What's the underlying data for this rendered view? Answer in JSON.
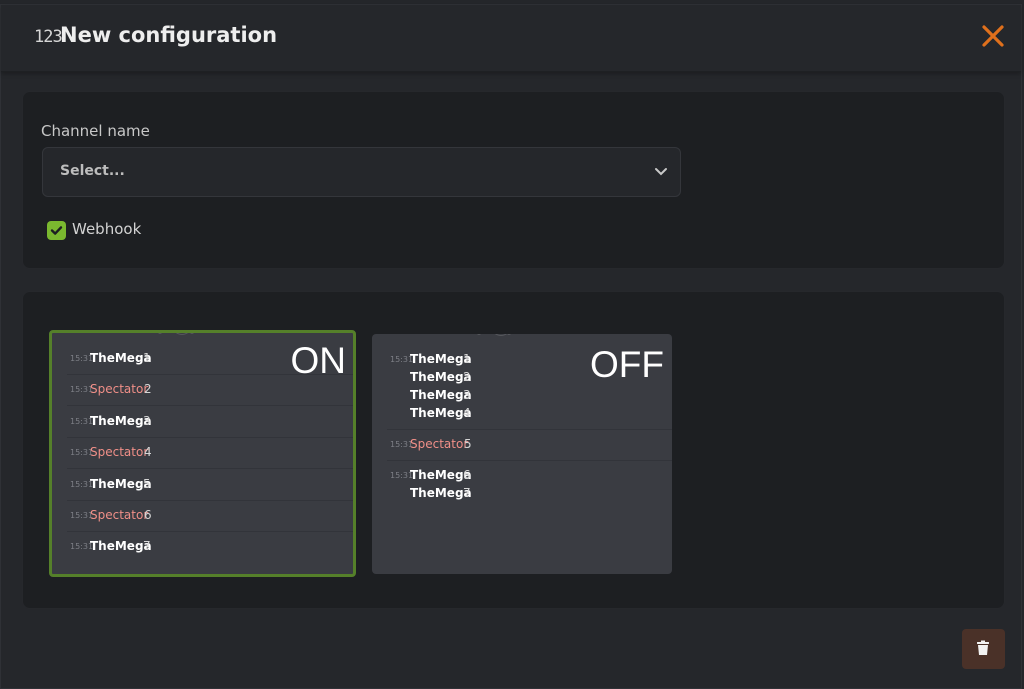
{
  "header": {
    "icon": "numbers-icon",
    "icon_text": "123",
    "title": "New configuration"
  },
  "form": {
    "channel_label": "Channel name",
    "channel_select_value": "Select...",
    "webhook_label": "Webhook",
    "webhook_checked": true
  },
  "preview_on": {
    "title": "ON",
    "messages": [
      {
        "time": "15:31",
        "user": "TheMega",
        "num": "1",
        "spectator": false
      },
      {
        "time": "15:31",
        "user": "Spectator",
        "num": "2",
        "spectator": true
      },
      {
        "time": "15:31",
        "user": "TheMega",
        "num": "3",
        "spectator": false
      },
      {
        "time": "15:31",
        "user": "Spectator",
        "num": "4",
        "spectator": true
      },
      {
        "time": "15:31",
        "user": "TheMega",
        "num": "5",
        "spectator": false
      },
      {
        "time": "15:31",
        "user": "Spectator",
        "num": "6",
        "spectator": true
      },
      {
        "time": "15:31",
        "user": "TheMega",
        "num": "7",
        "spectator": false
      }
    ]
  },
  "preview_off": {
    "title": "OFF",
    "groups": [
      {
        "time": "15:31",
        "user": "TheMega",
        "lines": [
          "1",
          "2",
          "3",
          "4"
        ],
        "spectator": false
      },
      {
        "time": "15:31",
        "user": "Spectator",
        "lines": [
          "5"
        ],
        "spectator": true
      },
      {
        "time": "15:31",
        "user": "TheMega",
        "lines": [
          "6",
          "7"
        ],
        "spectator": false
      }
    ]
  },
  "colors": {
    "accent_close": "#e0701c",
    "checkbox": "#7ab82f",
    "on_border": "#55802a",
    "spectator": "#f08f88",
    "delete_bg": "#4a3128"
  },
  "icons": {
    "close": "close-icon",
    "chevron": "chevron-down-icon",
    "check": "check-icon",
    "delete": "trash-icon"
  }
}
